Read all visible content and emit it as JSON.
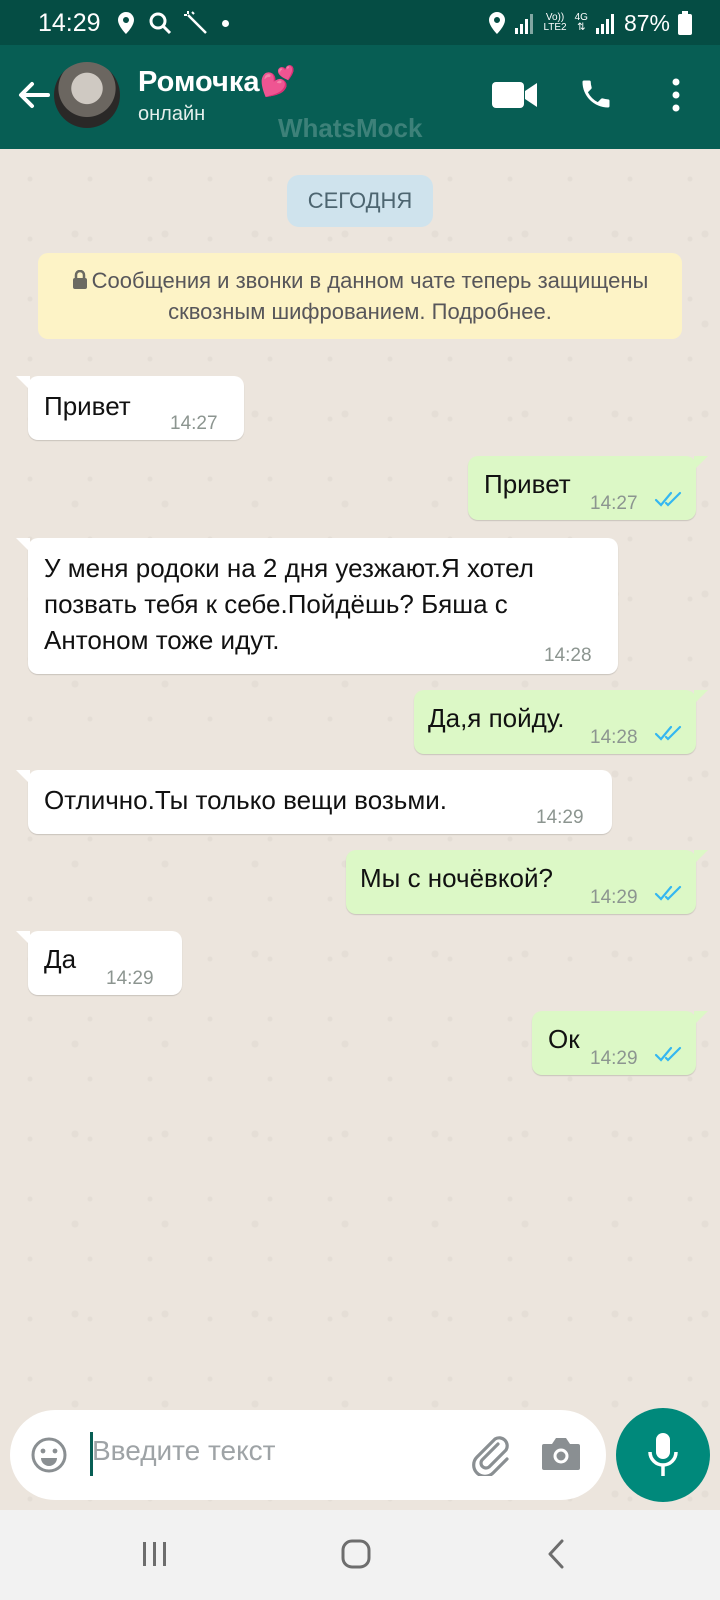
{
  "status_bar": {
    "time": "14:29",
    "network_label_top": "Vo))",
    "network_label_bottom": "LTE2",
    "network_type": "4G",
    "battery": "87%"
  },
  "header": {
    "contact_name": "Ромочка💕",
    "contact_status": "онлайн",
    "watermark": "WhatsMock"
  },
  "chat": {
    "date_label": "СЕГОДНЯ",
    "encryption_notice": "Сообщения и звонки в данном чате теперь защищены сквозным шифрованием. Подробнее.",
    "messages": [
      {
        "dir": "in",
        "text": "Привет",
        "time": "14:27"
      },
      {
        "dir": "out",
        "text": "Привет",
        "time": "14:27"
      },
      {
        "dir": "in",
        "text": "У меня родоки на 2 дня уезжают.Я хотел позвать тебя к себе.Пойдёшь? Бяша с Антоном тоже идут.",
        "time": "14:28"
      },
      {
        "dir": "out",
        "text": "Да,я пойду.",
        "time": "14:28"
      },
      {
        "dir": "in",
        "text": "Отлично.Ты только вещи возьми.",
        "time": "14:29"
      },
      {
        "dir": "out",
        "text": "Мы с ночёвкой?",
        "time": "14:29"
      },
      {
        "dir": "in",
        "text": "Да",
        "time": "14:29"
      },
      {
        "dir": "out",
        "text": "Ок",
        "time": "14:29"
      }
    ]
  },
  "input": {
    "placeholder": "Введите текст"
  },
  "colors": {
    "header": "#075e54",
    "outgoing_bubble": "#dcf8c6",
    "incoming_bubble": "#ffffff",
    "chat_bg": "#ece5dd",
    "read_tick": "#34b7f1",
    "mic_button": "#00897b"
  },
  "icons": [
    "back-arrow-icon",
    "video-call-icon",
    "phone-icon",
    "more-options-icon",
    "lock-icon",
    "emoji-icon",
    "attach-icon",
    "camera-icon",
    "mic-icon",
    "double-tick-icon",
    "nav-recents-icon",
    "nav-home-icon",
    "nav-back-icon"
  ]
}
